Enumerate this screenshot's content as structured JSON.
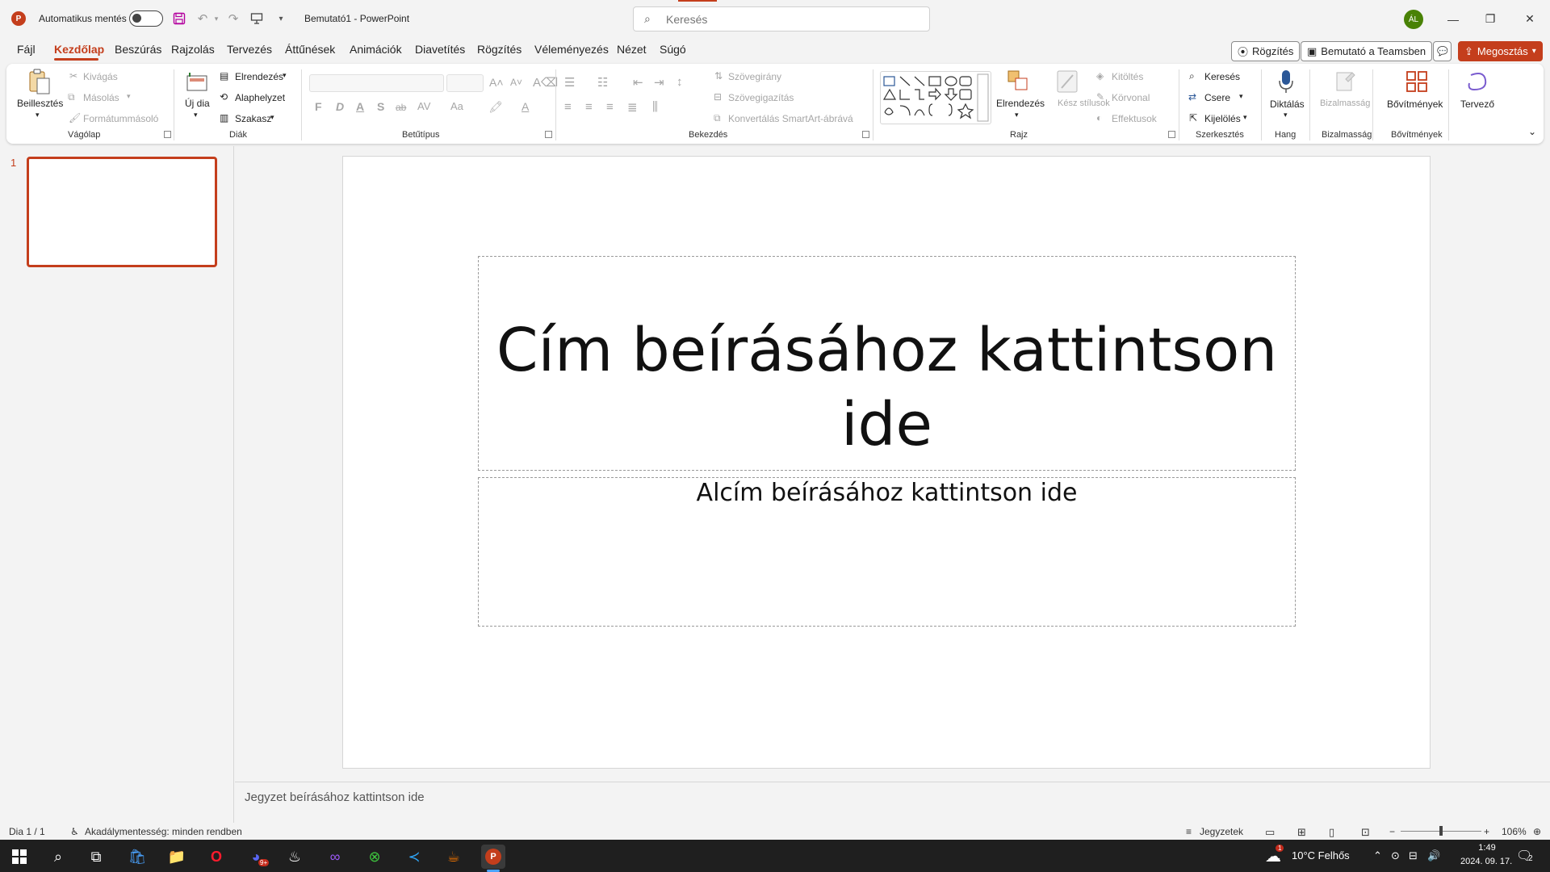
{
  "colors": {
    "accent": "#c43e1c",
    "avatar": "#498205",
    "taskbar": "#1f1f1f"
  },
  "titlebar": {
    "app_icon": "powerpoint-icon",
    "autosave_label": "Automatikus mentés",
    "autosave_state": "off",
    "doc_title": "Bemutató1  -  PowerPoint",
    "search_placeholder": "Keresés",
    "avatar_initials": "ÁL",
    "quick_access": [
      "save-icon",
      "undo-icon",
      "redo-icon",
      "present-from-start-icon",
      "customize-qat-icon"
    ],
    "window_controls": [
      "minimize-icon",
      "restore-icon",
      "close-icon"
    ]
  },
  "menu": {
    "tabs": [
      "Fájl",
      "Kezdőlap",
      "Beszúrás",
      "Rajzolás",
      "Tervezés",
      "Áttűnések",
      "Animációk",
      "Diavetítés",
      "Rögzítés",
      "Véleményezés",
      "Nézet",
      "Súgó"
    ],
    "active_tab": "Kezdőlap",
    "record_button": "Rögzítés",
    "teams_button": "Bemutató a Teamsben",
    "share_button": "Megosztás"
  },
  "ribbon": {
    "clipboard": {
      "group": "Vágólap",
      "paste": "Beillesztés",
      "cut": "Kivágás",
      "copy": "Másolás",
      "format_painter": "Formátummásoló"
    },
    "slides": {
      "group": "Diák",
      "new_slide": "Új dia",
      "layout": "Elrendezés",
      "reset": "Alaphelyzet",
      "section": "Szakasz"
    },
    "font": {
      "group": "Betűtípus",
      "bold": "F",
      "italic": "D",
      "underline": "A",
      "shadow": "S",
      "strike": "ab",
      "case": "Aa"
    },
    "paragraph": {
      "group": "Bekezdés",
      "text_direction": "Szövegirány",
      "align_text": "Szövegigazítás",
      "smartart": "Konvertálás SmartArt-ábrává"
    },
    "drawing": {
      "group": "Rajz",
      "arrange": "Elrendezés",
      "quick_styles": "Kész stílusok",
      "fill": "Kitöltés",
      "outline": "Körvonal",
      "effects": "Effektusok"
    },
    "editing": {
      "group": "Szerkesztés",
      "find": "Keresés",
      "replace": "Csere",
      "select": "Kijelölés"
    },
    "voice": {
      "group": "Hang",
      "dictate": "Diktálás"
    },
    "sensitivity": {
      "group": "Bizalmasság",
      "label": "Bizalmasság"
    },
    "addins": {
      "group": "Bővítmények",
      "label": "Bővítmények"
    },
    "designer": {
      "label": "Tervező"
    }
  },
  "thumbnails": {
    "slide_number": "1"
  },
  "slide": {
    "title_placeholder": "Cím beírásához kattintson ide",
    "subtitle_placeholder": "Alcím beírásához kattintson ide"
  },
  "notes": {
    "placeholder": "Jegyzet beírásához kattintson ide"
  },
  "status": {
    "slide_counter": "Dia 1 / 1",
    "accessibility": "Akadálymentesség: minden rendben",
    "notes_button": "Jegyzetek",
    "zoom": "106%"
  },
  "taskbar": {
    "apps": [
      "windows-start-icon",
      "search-icon",
      "task-view-icon",
      "store-icon",
      "file-explorer-icon",
      "opera-icon",
      "discord-icon",
      "steam-icon",
      "visual-studio-icon",
      "xbox-icon",
      "vscode-icon",
      "java-icon",
      "powerpoint-icon"
    ],
    "discord_badge": "9+",
    "weather": "10°C  Felhős",
    "weather_badge": "1",
    "time": "1:49",
    "date": "2024. 09. 17.",
    "notification_count": "2"
  }
}
